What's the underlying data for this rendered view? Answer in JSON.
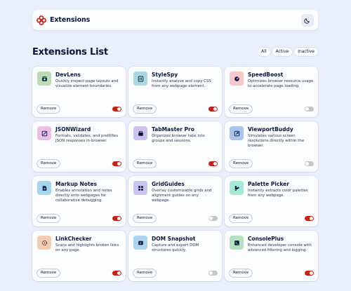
{
  "header": {
    "brand_name": "Extensions",
    "brand_icon": "extensions-logo-icon",
    "theme_icon": "moon-icon"
  },
  "list": {
    "title": "Extensions List",
    "filters": [
      "All",
      "Active",
      "Inactive"
    ]
  },
  "colors": {
    "accent": "#c7221a",
    "toggle_off": "#c6c6c6",
    "background": "#eaf0fb",
    "card": "#fbfdfe"
  },
  "extensions": [
    {
      "name": "DevLens",
      "description": "Quickly inspect page layouts and visualize element boundaries.",
      "icon": "devlens-icon",
      "icon_bg": "#b9dcb4",
      "active": true,
      "remove_label": "Remove"
    },
    {
      "name": "StyleSpy",
      "description": "Instantly analyze and copy CSS from any webpage element.",
      "icon": "stylespy-icon",
      "icon_bg": "#a9d7e2",
      "active": true,
      "remove_label": "Remove"
    },
    {
      "name": "SpeedBoost",
      "description": "Optimizes browser resource usage to accelerate page loading.",
      "icon": "speedboost-icon",
      "icon_bg": "#f7c7cc",
      "active": false,
      "remove_label": "Remove"
    },
    {
      "name": "JSONWizard",
      "description": "Formats, validates, and prettifies JSON responses in-browser.",
      "icon": "jsonwizard-icon",
      "icon_bg": "#edc1e6",
      "active": true,
      "remove_label": "Remove"
    },
    {
      "name": "TabMaster Pro",
      "description": "Organizes browser tabs into groups and sessions.",
      "icon": "tabmaster-icon",
      "icon_bg": "#cfc1ef",
      "active": true,
      "remove_label": "Remove"
    },
    {
      "name": "ViewportBuddy",
      "description": "Simulates various screen resolutions directly within the browser.",
      "icon": "viewportbuddy-icon",
      "icon_bg": "#a9c5ef",
      "active": false,
      "remove_label": "Remove"
    },
    {
      "name": "Markup Notes",
      "description": "Enables annotation and notes directly onto webpages for collaborative debugging.",
      "icon": "markup-notes-icon",
      "icon_bg": "#a6d6ef",
      "active": true,
      "remove_label": "Remove"
    },
    {
      "name": "GridGuides",
      "description": "Overlay customizable grids and alignment guides on any webpage.",
      "icon": "gridguides-icon",
      "icon_bg": "#c9c5f0",
      "active": false,
      "remove_label": "Remove"
    },
    {
      "name": "Palette Picker",
      "description": "Instantly extracts color palettes from any webpage.",
      "icon": "palette-picker-icon",
      "icon_bg": "#a6ead5",
      "active": true,
      "remove_label": "Remove"
    },
    {
      "name": "LinkChecker",
      "description": "Scans and highlights broken links on any page.",
      "icon": "linkchecker-icon",
      "icon_bg": "#f7cbb1",
      "active": true,
      "remove_label": "Remove"
    },
    {
      "name": "DOM Snapshot",
      "description": "Capture and export DOM structures quickly.",
      "icon": "dom-snapshot-icon",
      "icon_bg": "#a9d3ef",
      "active": false,
      "remove_label": "Remove"
    },
    {
      "name": "ConsolePlus",
      "description": "Enhanced developer console with advanced filtering and logging.",
      "icon": "consoleplus-icon",
      "icon_bg": "#b4e0bd",
      "active": true,
      "remove_label": "Remove"
    }
  ]
}
